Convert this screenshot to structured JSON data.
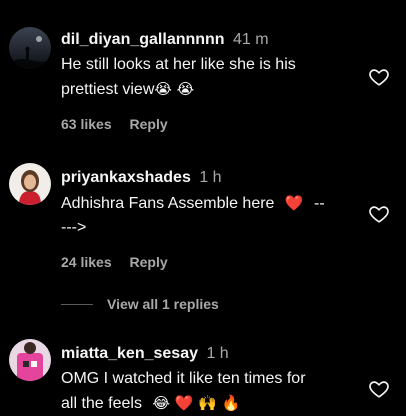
{
  "comments": [
    {
      "username": "dil_diyan_gallannnnn",
      "time": "41 m",
      "text_line1": "He still looks at her like she is his",
      "text_line2": "prettiest view",
      "emojis_line2": "😭 😭",
      "likes": "63 likes",
      "reply": "Reply",
      "avatar_icon": "silhouette-night-sky-avatar"
    },
    {
      "username": "priyankaxshades",
      "time": "1 h",
      "text_line1": "Adhishra Fans Assemble here",
      "emojis_line1": "❤️",
      "text_line1_tail": "--",
      "text_line2": "--->",
      "likes": "24 likes",
      "reply": "Reply",
      "avatar_icon": "woman-portrait-avatar"
    },
    {
      "username": "miatta_ken_sesay",
      "time": "1 h",
      "text_line1": "OMG I watched it like ten times for",
      "text_line2": "all the feels",
      "emojis_line2": "😂 ❤️ 🙌 🔥",
      "avatar_icon": "pink-outfit-person-avatar"
    }
  ],
  "view_replies": "View all 1 replies",
  "colors": {
    "background": "#000000",
    "text": "#f5f5f5",
    "muted": "#a8a8a8"
  }
}
